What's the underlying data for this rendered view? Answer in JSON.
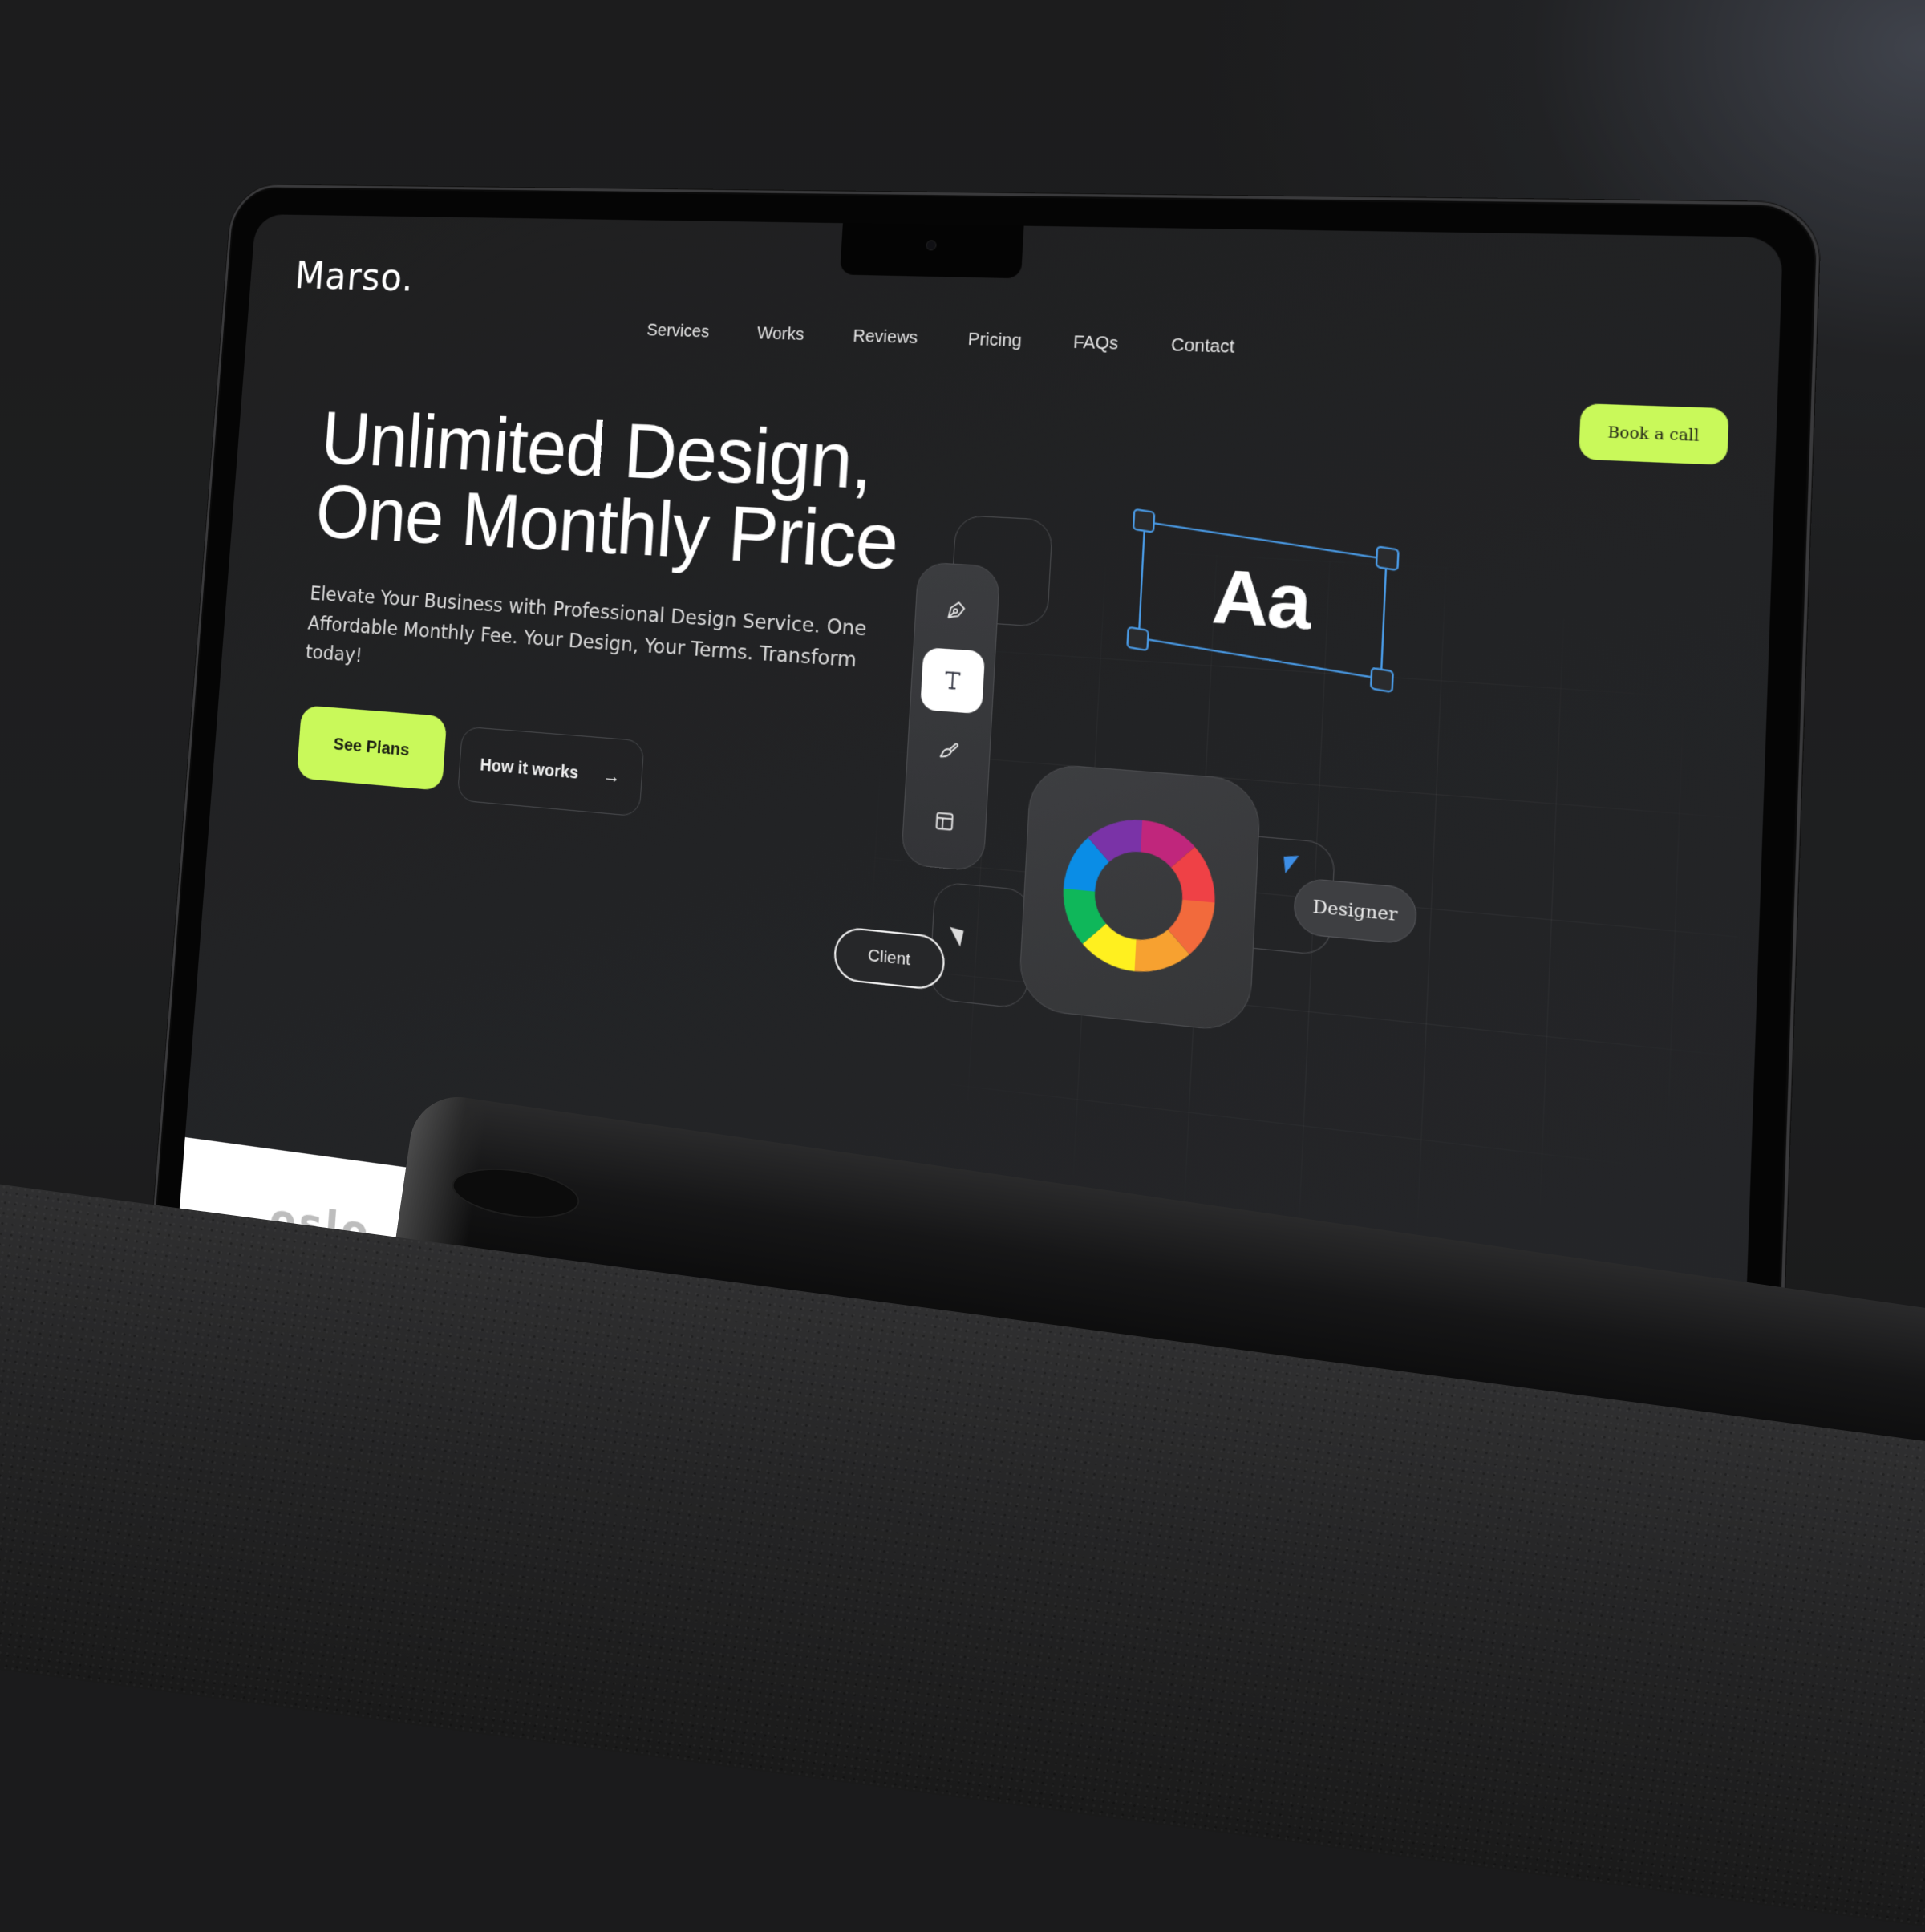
{
  "site": {
    "logo": "Marso.",
    "nav": [
      "Services",
      "Works",
      "Reviews",
      "Pricing",
      "FAQs",
      "Contact"
    ],
    "cta": "Book a call"
  },
  "hero": {
    "title_line1": "Unlimited Design,",
    "title_line2": "One Monthly Price",
    "subtitle": "Elevate Your Business with Professional Design Service. One Affordable Monthly Fee. Your Design, Your Terms. Transform today!",
    "primary_button": "See Plans",
    "secondary_button": "How it works",
    "secondary_icon": "→"
  },
  "illustration": {
    "tools": [
      {
        "name": "pen-tool-icon",
        "active": false
      },
      {
        "name": "text-tool-icon",
        "active": true
      },
      {
        "name": "brush-tool-icon",
        "active": false
      },
      {
        "name": "layout-tool-icon",
        "active": false
      }
    ],
    "selection_text": "Aa",
    "selection_color": "#4a9be6",
    "client_label": "Client",
    "designer_label": "Designer",
    "designer_cursor_color": "#3d8ee6",
    "color_wheel": [
      "#c0267c",
      "#ef4146",
      "#f26a3c",
      "#f7a130",
      "#fff01f",
      "#0fb75a",
      "#0a8de6",
      "#7a33a7"
    ]
  },
  "next_section": {
    "client_logo": "oslo."
  },
  "colors": {
    "accent": "#c9f95a",
    "background": "#1f2022"
  }
}
